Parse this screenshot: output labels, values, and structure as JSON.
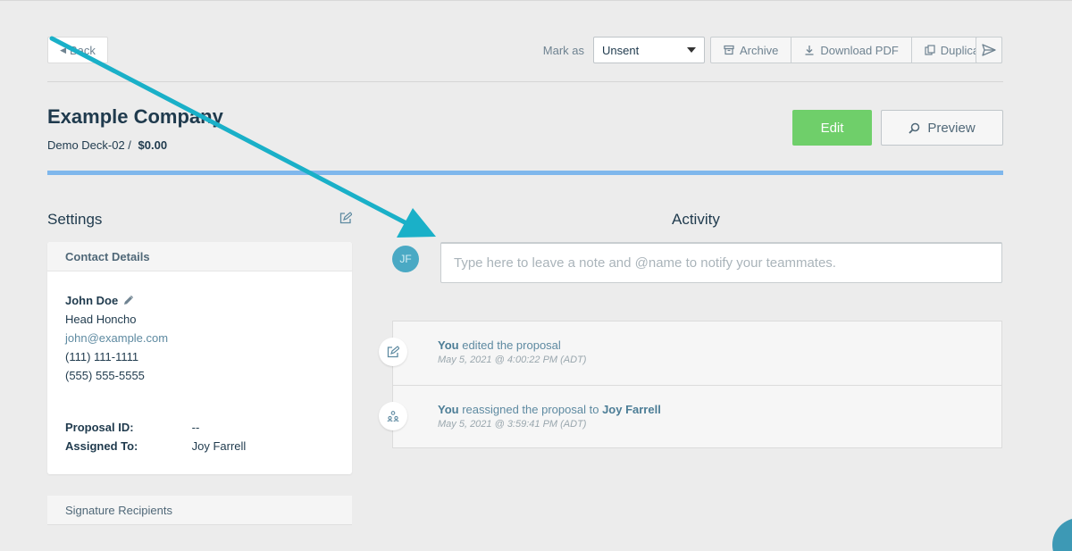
{
  "header": {
    "back_label": "Back",
    "mark_as_label": "Mark as",
    "status_value": "Unsent",
    "archive_label": "Archive",
    "download_label": "Download PDF",
    "duplicate_label": "Duplicate"
  },
  "proposal": {
    "company": "Example Company",
    "deck": "Demo Deck-02 /",
    "amount": "$0.00",
    "edit_label": "Edit",
    "preview_label": "Preview"
  },
  "settings": {
    "title": "Settings",
    "contact_header": "Contact Details",
    "contact": {
      "name": "John Doe",
      "role": "Head Honcho",
      "email": "john@example.com",
      "phone1": "(111) 111-1111",
      "phone2": "(555) 555-5555"
    },
    "proposal_id_label": "Proposal ID:",
    "proposal_id_value": "--",
    "assigned_label": "Assigned To:",
    "assigned_value": "Joy Farrell",
    "signature_header": "Signature Recipients"
  },
  "activity": {
    "title": "Activity",
    "avatar_initials": "JF",
    "note_placeholder": "Type here to leave a note and @name to notify your teammates.",
    "items": [
      {
        "actor": "You",
        "text": "edited the proposal",
        "target": "",
        "time": "May 5, 2021 @ 4:00:22 PM (ADT)"
      },
      {
        "actor": "You",
        "text": "reassigned the proposal to",
        "target": "Joy Farrell",
        "time": "May 5, 2021 @ 3:59:41 PM (ADT)"
      }
    ]
  },
  "colors": {
    "accent_blue": "#7fb7ec",
    "edit_green": "#6fcf6a",
    "annotation_arrow": "#1ab0c8"
  }
}
